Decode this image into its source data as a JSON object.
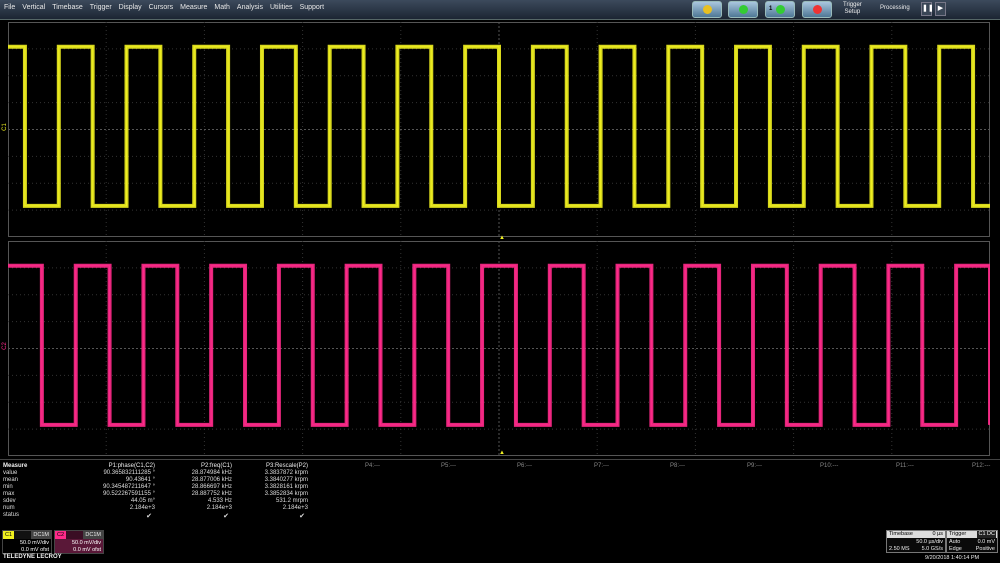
{
  "menu": [
    "File",
    "Vertical",
    "Timebase",
    "Trigger",
    "Display",
    "Cursors",
    "Measure",
    "Math",
    "Analysis",
    "Utilities",
    "Support"
  ],
  "toolbar": {
    "buttons": [
      {
        "num": "",
        "color": "#e8c020"
      },
      {
        "num": "",
        "color": "#3c3"
      },
      {
        "num": "1",
        "color": "#3c3"
      },
      {
        "num": "",
        "color": "#e33"
      }
    ],
    "trigger_setup": [
      "Trigger",
      "Setup"
    ],
    "processing": "Processing",
    "pause_icon": "pause-icon",
    "play_icon": "play-icon"
  },
  "channels": {
    "c1": {
      "label": "C1",
      "color": "#f0f020",
      "periods": 14.5
    },
    "c2": {
      "label": "C2",
      "color": "#ff2a8a",
      "periods": 14.5
    }
  },
  "measure": {
    "title": "Measure",
    "rows": [
      "value",
      "mean",
      "min",
      "max",
      "sdev",
      "num",
      "status"
    ],
    "params": [
      {
        "header": "P1:phase(C1,C2)",
        "cells": [
          "90.365832111285 °",
          "90.43641 °",
          "90.345487211647 °",
          "90.522267591155 °",
          "44.05 m°",
          "2.184e+3"
        ]
      },
      {
        "header": "P2:freq(C1)",
        "cells": [
          "28.874984 kHz",
          "28.877006 kHz",
          "28.866697 kHz",
          "28.887752 kHz",
          "4.533 Hz",
          "2.184e+3"
        ]
      },
      {
        "header": "P3:Rescale(P2)",
        "cells": [
          "3.3837872 krpm",
          "3.3840277 krpm",
          "3.3828161 krpm",
          "3.3852834 krpm",
          "531.2 mrpm",
          "2.184e+3"
        ]
      }
    ],
    "empty_slots": [
      "P4:---",
      "P5:---",
      "P6:---",
      "P7:---",
      "P8:---",
      "P9:---",
      "P10:---",
      "P11:---",
      "P12:---"
    ]
  },
  "descriptors": {
    "c1": {
      "name": "C1",
      "tag": "DC1M",
      "vdiv": "50.0 mV/div",
      "offset": "0.0 mV ofst"
    },
    "c2": {
      "name": "C2",
      "tag": "DC1M",
      "vdiv": "50.0 mV/div",
      "offset": "0.0 mV ofst"
    }
  },
  "brand": "TELEDYNE LECROY",
  "timebase": {
    "title": "Timebase",
    "delay": "0 µs",
    "per_div": "50.0 µs/div",
    "samples": "2.50 MS",
    "rate": "5.0 GS/s"
  },
  "trigger": {
    "title": "Trigger",
    "tag": "C1 DC",
    "mode": "Auto",
    "level": "0.0 mV",
    "type": "Edge",
    "slope": "Positive"
  },
  "datetime": "9/20/2018 1:40:14 PM"
}
